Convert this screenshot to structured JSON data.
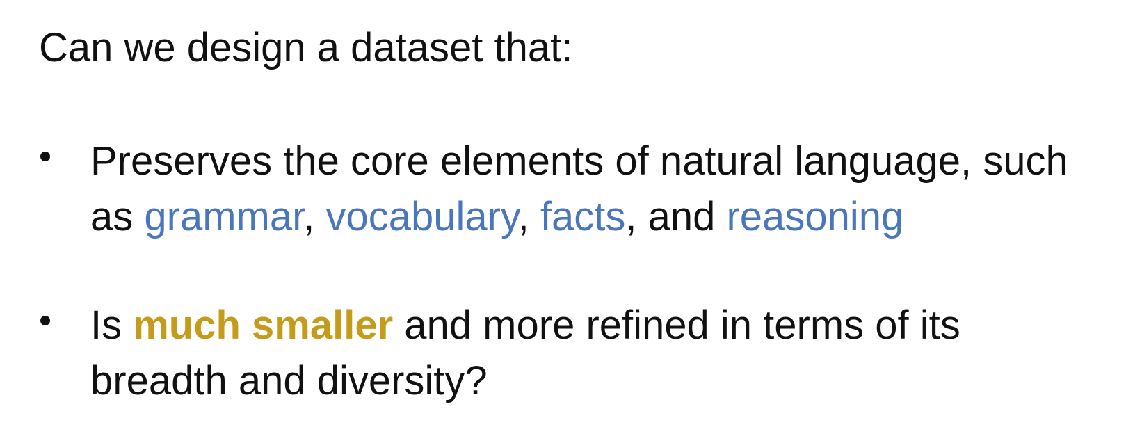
{
  "title": "Can we design a dataset that:",
  "bullets": [
    {
      "line1": "Preserves the core elements of natural language, such",
      "line2_prefix": "as ",
      "grammar": "grammar",
      "sep1": ", ",
      "vocabulary": "vocabulary",
      "sep2": ", ",
      "facts": "facts",
      "sep3": ", and ",
      "reasoning": "reasoning"
    },
    {
      "prefix": "Is ",
      "highlight": "much smaller",
      "rest": " and more refined in terms of its",
      "line2": "breadth and diversity?"
    }
  ],
  "colors": {
    "text": "#111111",
    "blue_keyword": "#4a76bd",
    "gold_keyword": "#c49b1a",
    "background": "#ffffff"
  }
}
